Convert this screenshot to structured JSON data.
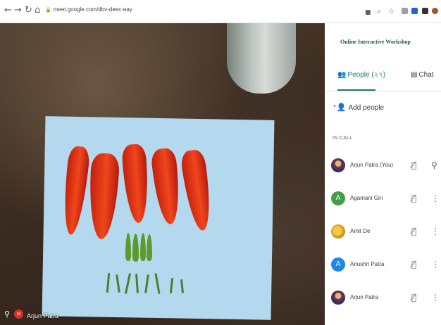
{
  "browser": {
    "url": "meet.google.com/dbv-deec-eay",
    "nav_icons": [
      "back-icon",
      "forward-icon",
      "reload-icon",
      "home-icon"
    ]
  },
  "video": {
    "self_name": "Arjun Patra"
  },
  "panel": {
    "title": "Online Interactive Workshop",
    "tabs": [
      {
        "label": "People (২৭)",
        "icon": "people-icon",
        "active": true
      },
      {
        "label": "Chat",
        "icon": "chat-icon",
        "active": false
      }
    ],
    "add_people_label": "Add people",
    "section_label": "IN CALL",
    "participants": [
      {
        "name": "Arjun Patra (You)",
        "avatar": "photo",
        "initial": "",
        "color": "#6b3f8a"
      },
      {
        "name": "Agamani Giri",
        "avatar": "letter",
        "initial": "A",
        "color": "#43a047"
      },
      {
        "name": "Amit De",
        "avatar": "photo",
        "initial": "",
        "color": "#e0a21c"
      },
      {
        "name": "Anushri Patra",
        "avatar": "letter",
        "initial": "A",
        "color": "#1e88e5"
      },
      {
        "name": "Arjun Patra",
        "avatar": "photo",
        "initial": "",
        "color": "#6b3f8a"
      }
    ]
  },
  "colors": {
    "accent": "#1a7f5a",
    "mic_off": "#d93025"
  }
}
